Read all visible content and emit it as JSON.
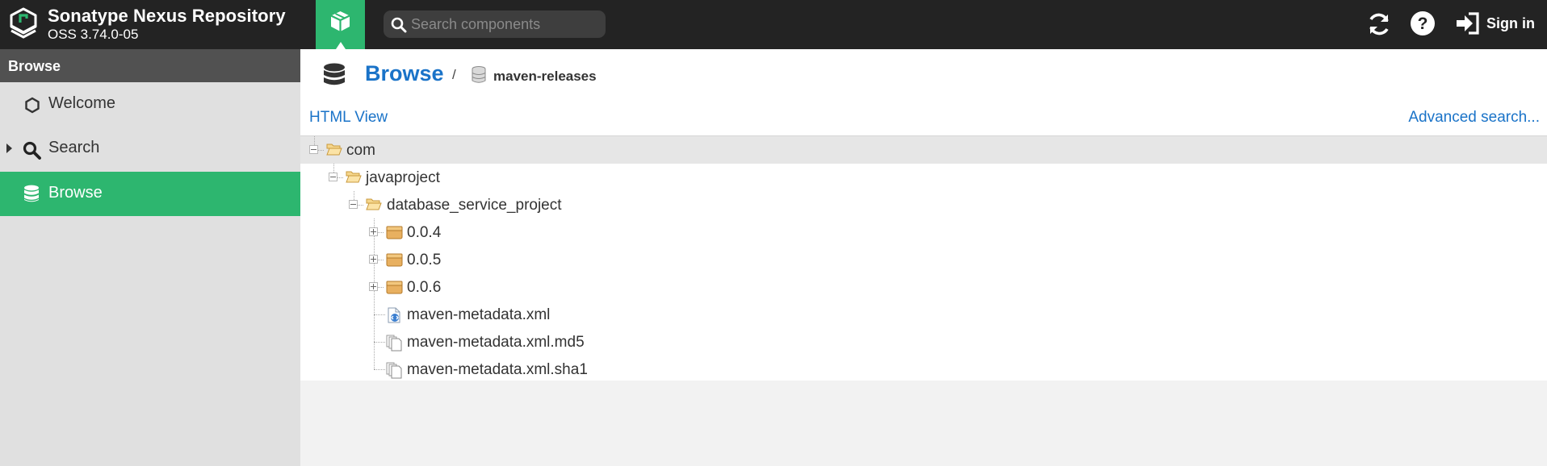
{
  "app": {
    "title": "Sonatype Nexus Repository",
    "version": "OSS 3.74.0-05"
  },
  "header": {
    "search_placeholder": "Search components",
    "signin_label": "Sign in",
    "icons": [
      "browse-cube-icon",
      "search-icon",
      "refresh-icon",
      "help-icon",
      "sign-in-icon"
    ]
  },
  "sidebar": {
    "header": "Browse",
    "items": [
      {
        "label": "Welcome",
        "icon": "hexagon-icon"
      },
      {
        "label": "Search",
        "icon": "search-icon"
      },
      {
        "label": "Browse",
        "icon": "database-icon",
        "active": true
      }
    ]
  },
  "breadcrumb": {
    "title": "Browse",
    "separator": "/",
    "repository": "maven-releases"
  },
  "links": {
    "html_view": "HTML View",
    "advanced_search": "Advanced search..."
  },
  "tree": [
    {
      "name": "com",
      "type": "folder-open",
      "expanded": true,
      "selected": true
    },
    {
      "name": "javaproject",
      "type": "folder-open",
      "expanded": true
    },
    {
      "name": "database_service_project",
      "type": "folder-open",
      "expanded": true
    },
    {
      "name": "0.0.4",
      "type": "component",
      "expanded": false
    },
    {
      "name": "0.0.5",
      "type": "component",
      "expanded": false
    },
    {
      "name": "0.0.6",
      "type": "component",
      "expanded": false
    },
    {
      "name": "maven-metadata.xml",
      "type": "xml-file"
    },
    {
      "name": "maven-metadata.xml.md5",
      "type": "file"
    },
    {
      "name": "maven-metadata.xml.sha1",
      "type": "file"
    }
  ],
  "colors": {
    "topbar": "#232323",
    "accent_green": "#2db66f",
    "link_blue": "#1a73c8",
    "sidebar_bg": "#e0e0e0",
    "sidebar_header": "#515151"
  }
}
